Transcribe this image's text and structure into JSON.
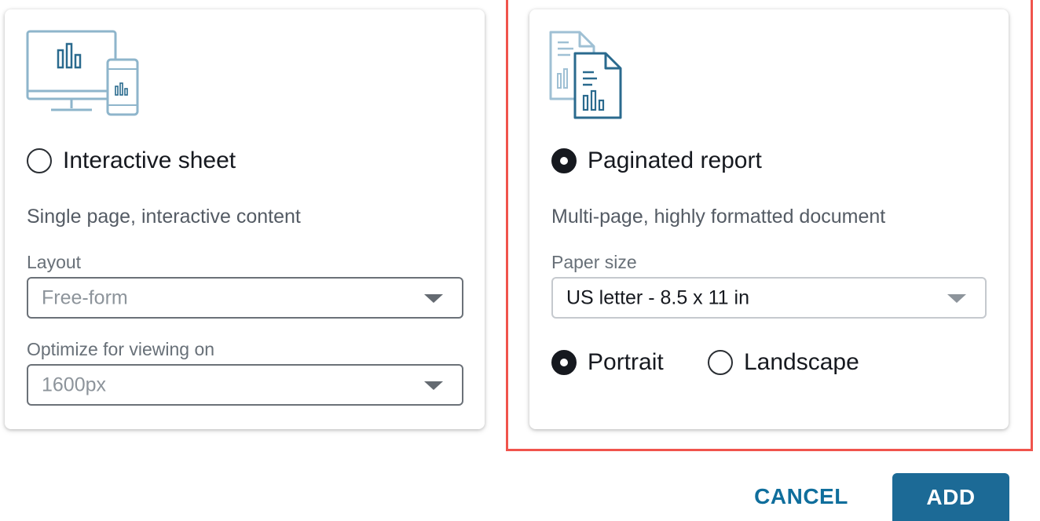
{
  "interactive_sheet": {
    "icon": "desktop-and-mobile-chart-icon",
    "option_label": "Interactive sheet",
    "selected": false,
    "description": "Single page, interactive content",
    "layout": {
      "label": "Layout",
      "value": "Free-form"
    },
    "viewing": {
      "label": "Optimize for viewing on",
      "value": "1600px"
    }
  },
  "paginated_report": {
    "icon": "paginated-document-chart-icon",
    "option_label": "Paginated report",
    "selected": true,
    "description": "Multi-page, highly formatted document",
    "paper_size": {
      "label": "Paper size",
      "value": "US letter - 8.5 x 11 in"
    },
    "orientation": {
      "options": [
        {
          "label": "Portrait",
          "selected": true
        },
        {
          "label": "Landscape",
          "selected": false
        }
      ]
    }
  },
  "actions": {
    "cancel_label": "CANCEL",
    "add_label": "ADD"
  },
  "colors": {
    "accent": "#1c6a96",
    "link": "#0f6e9c",
    "highlight_border": "#f0544c",
    "icon_primary": "#2a6a8e",
    "icon_secondary": "#9fc0d4"
  }
}
